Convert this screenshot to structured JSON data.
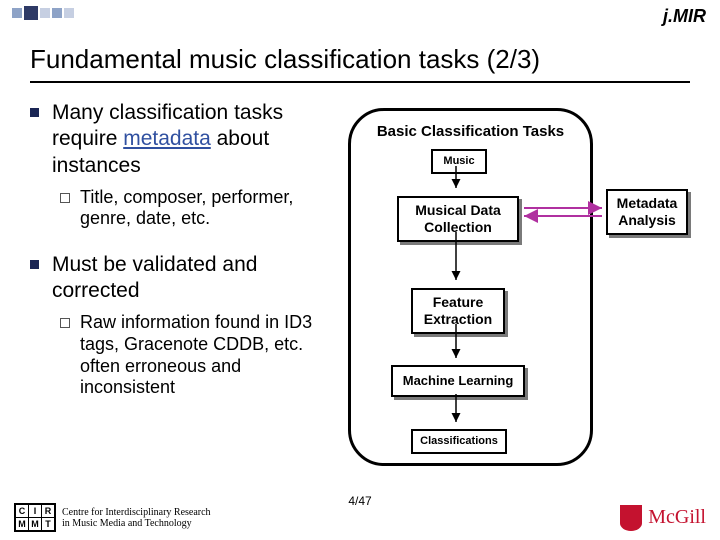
{
  "logo_jmir": "j.MIR",
  "title": "Fundamental music classification tasks (2/3)",
  "bullets": [
    {
      "text_pre": "Many classification tasks require ",
      "link": "metadata",
      "text_post": " about instances",
      "sub": "Title, composer, performer, genre, date, etc."
    },
    {
      "text": "Must be validated and corrected",
      "sub": "Raw information found in ID3 tags, Gracenote CDDB, etc. often erroneous and inconsistent"
    }
  ],
  "diagram": {
    "panel_title": "Basic Classification Tasks",
    "music": "Music",
    "mdc": "Musical Data Collection",
    "feature": "Feature Extraction",
    "ml": "Machine Learning",
    "class": "Classifications",
    "meta": "Metadata Analysis"
  },
  "page": "4/47",
  "footer": {
    "cirmmt_letters": [
      "C",
      "I",
      "R",
      "M",
      "M",
      "T"
    ],
    "cirmmt_line1": "Centre for Interdisciplinary Research",
    "cirmmt_line2": "in Music Media and Technology",
    "mcgill": "McGill"
  }
}
